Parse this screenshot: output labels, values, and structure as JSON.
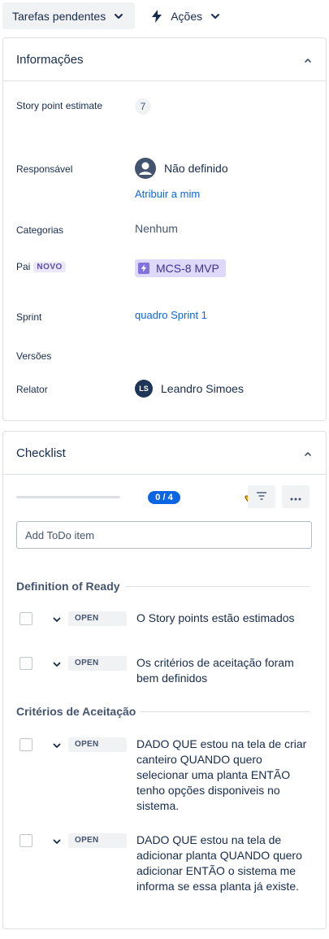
{
  "toolbar": {
    "status_label": "Tarefas pendentes",
    "actions_label": "Ações"
  },
  "info": {
    "title": "Informações",
    "story_points_label": "Story point estimate",
    "story_points_value": "7",
    "assignee_label": "Responsável",
    "assignee_value": "Não definido",
    "assign_to_me": "Atribuir a mim",
    "categories_label": "Categorias",
    "categories_value": "Nenhum",
    "parent_label": "Pai",
    "parent_badge": "NOVO",
    "parent_value": "MCS-8 MVP",
    "sprint_label": "Sprint",
    "sprint_value": "quadro Sprint 1",
    "versions_label": "Versões",
    "reporter_label": "Relator",
    "reporter_initials": "LS",
    "reporter_value": "Leandro Simoes"
  },
  "checklist": {
    "title": "Checklist",
    "progress_text": "0 / 4",
    "progress": 0,
    "add_placeholder": "Add ToDo item",
    "sections": [
      {
        "title": "Definition of Ready",
        "items": [
          {
            "status": "OPEN",
            "text": "O Story points estão estimados"
          },
          {
            "status": "OPEN",
            "text": "Os critérios de aceitação foram bem definidos"
          }
        ]
      },
      {
        "title": "Critérios de Aceitação",
        "items": [
          {
            "status": "OPEN",
            "text": "DADO QUE estou na tela de criar canteiro QUANDO quero selecionar uma planta ENTÃO tenho opções disponiveis no sistema."
          },
          {
            "status": "OPEN",
            "text": "DADO QUE estou na tela de adicionar planta QUANDO quero adicionar ENTÃO o sistema me informa se essa planta já existe."
          }
        ]
      }
    ]
  },
  "colors": {
    "accent": "#0c66e4",
    "epic": "#8270db",
    "text": "#172b4d"
  }
}
